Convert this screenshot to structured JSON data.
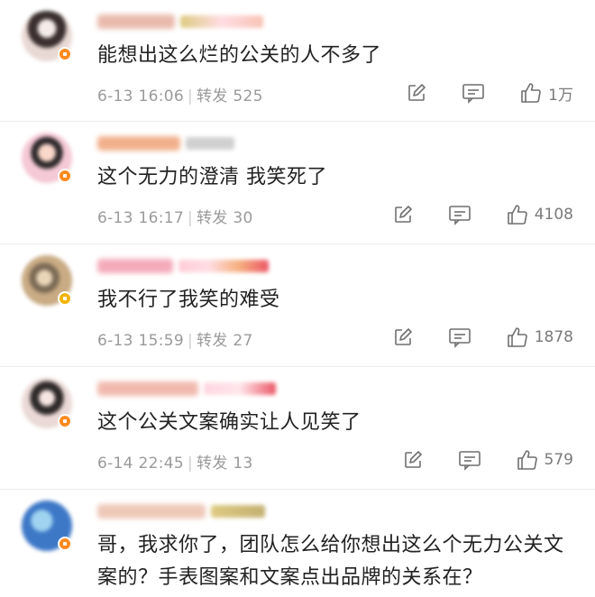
{
  "comments": [
    {
      "text": "能想出这么烂的公关的人不多了",
      "date": "6-13 16:06",
      "repost_label": "转发",
      "repost_count": "525",
      "likes": "1万",
      "avatar_colors": [
        "#e9d9d4",
        "#3b302f"
      ],
      "name_colors": [
        "#e7b3a4",
        "#cfcfcf"
      ]
    },
    {
      "text": "这个无力的澄清 我笑死了",
      "date": "6-13 16:17",
      "repost_label": "转发",
      "repost_count": "30",
      "likes": "4108",
      "avatar_colors": [
        "#f5c9d6",
        "#2e2a2c"
      ],
      "name_colors": [
        "#f0a87f",
        "#c8c8c8"
      ]
    },
    {
      "text": "我不行了我笑的难受",
      "date": "6-13 15:59",
      "repost_label": "转发",
      "repost_count": "27",
      "likes": "1878",
      "avatar_colors": [
        "#c9ab84",
        "#7b6a55"
      ],
      "name_colors": [
        "#f3a3b3",
        "#ffc4d0"
      ]
    },
    {
      "text": "这个公关文案确实让人见笑了",
      "date": "6-14 22:45",
      "repost_label": "转发",
      "repost_count": "13",
      "likes": "579",
      "avatar_colors": [
        "#ead9d6",
        "#2f2a2a"
      ],
      "name_colors": [
        "#f0b2a6",
        "#ffd0dc"
      ]
    },
    {
      "text": "哥，我求你了，团队怎么给你想出这么个无力公关文案的？手表图案和文案点出品牌的关系在？",
      "avatar_colors": [
        "#3d78c7",
        "#9fd3f0"
      ],
      "name_colors": [
        "#ecc2b0",
        "#d9c16a"
      ]
    }
  ],
  "icons": {
    "comment_edit": "edit-square-icon",
    "reply": "comment-bubble-icon",
    "like": "thumbs-up-icon"
  }
}
